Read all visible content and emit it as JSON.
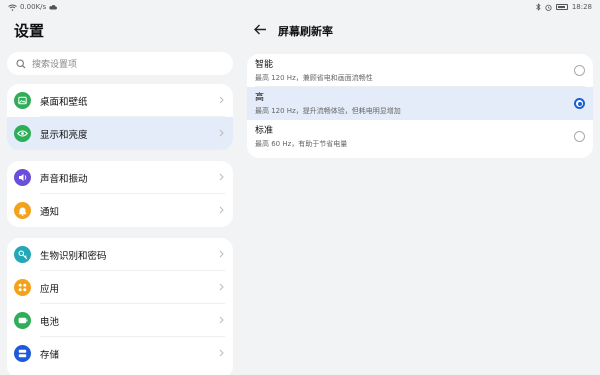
{
  "status": {
    "speed": "0.00K/s",
    "time": "18:28"
  },
  "left": {
    "title": "设置",
    "search_placeholder": "搜索设置项",
    "groups": [
      [
        {
          "label": "桌面和壁纸",
          "icon": "wallpaper-icon",
          "color": "#2fae59",
          "selected": false
        },
        {
          "label": "显示和亮度",
          "icon": "eye-icon",
          "color": "#2fae59",
          "selected": true
        }
      ],
      [
        {
          "label": "声音和振动",
          "icon": "speaker-icon",
          "color": "#6a4fd8",
          "selected": false
        },
        {
          "label": "通知",
          "icon": "bell-icon",
          "color": "#f4a21c",
          "selected": false
        }
      ],
      [
        {
          "label": "生物识别和密码",
          "icon": "key-icon",
          "color": "#22a8b8",
          "selected": false
        },
        {
          "label": "应用",
          "icon": "apps-icon",
          "color": "#f4a21c",
          "selected": false
        },
        {
          "label": "电池",
          "icon": "battery-icon",
          "color": "#2fae59",
          "selected": false
        },
        {
          "label": "存储",
          "icon": "storage-icon",
          "color": "#1f5bd6",
          "selected": false
        }
      ]
    ]
  },
  "right": {
    "title": "屏幕刷新率",
    "options": [
      {
        "title": "智能",
        "desc": "最高 120 Hz，兼顾省电和画面流畅性",
        "checked": false
      },
      {
        "title": "高",
        "desc": "最高 120 Hz，提升流畅体验，但耗电明显增加",
        "checked": true
      },
      {
        "title": "标准",
        "desc": "最高 60 Hz，有助于节省电量",
        "checked": false
      }
    ]
  },
  "colors": {
    "accent": "#1a5fd6",
    "selected_bg": "#e3ecf8",
    "background": "#f1f3f5"
  }
}
